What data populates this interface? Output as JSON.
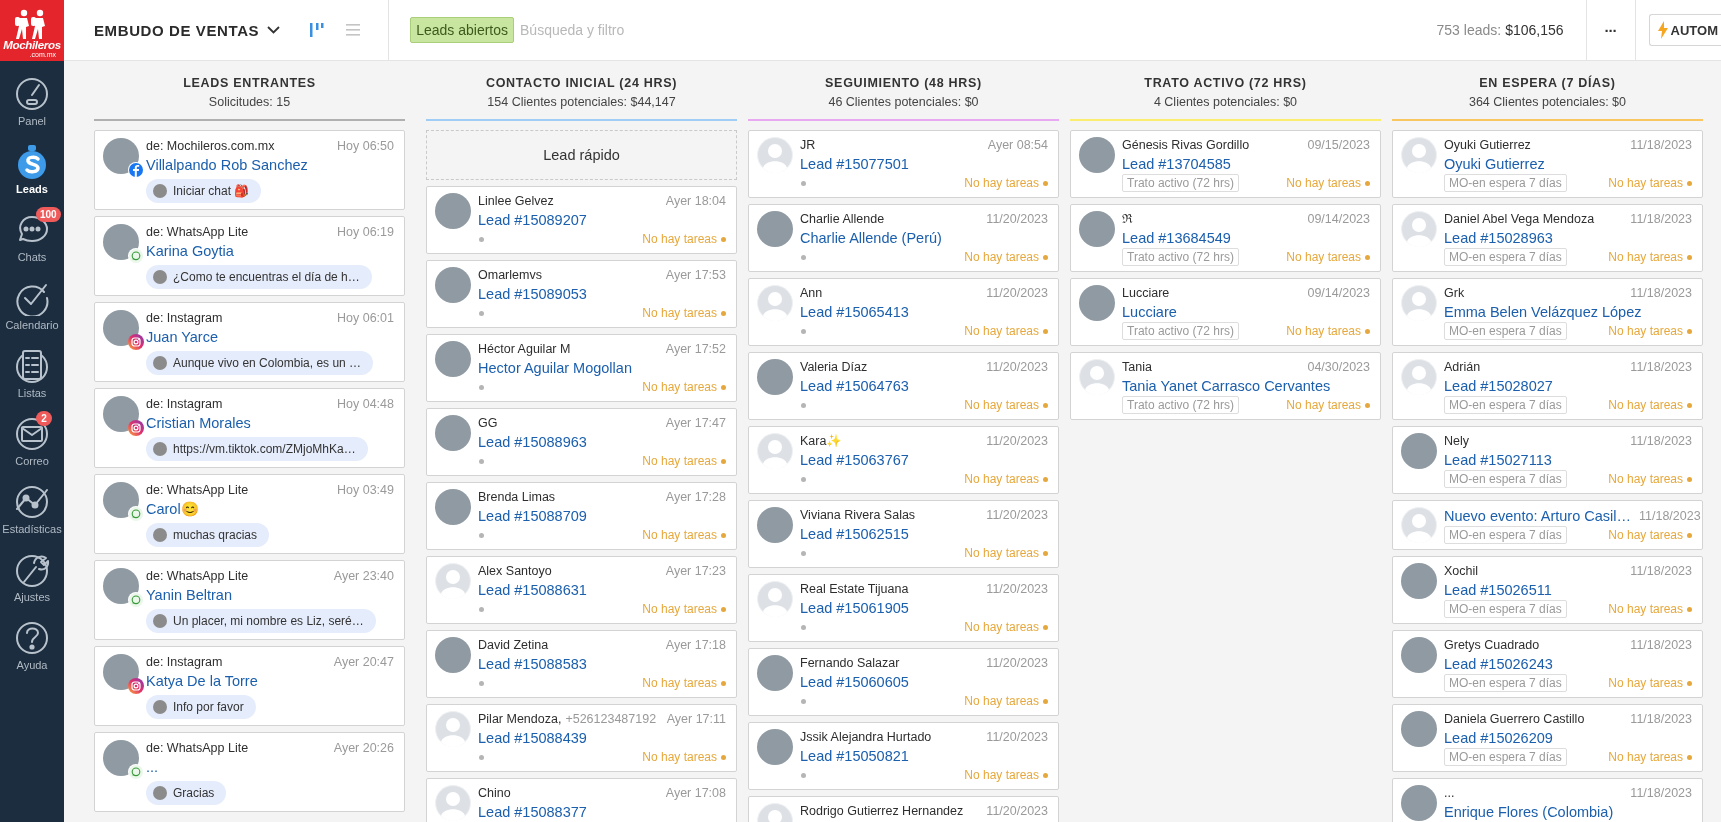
{
  "sidebar": {
    "logo": {
      "name": "Mochileros",
      "domain": ".com.mx"
    },
    "items": [
      {
        "label": "Panel",
        "kind": "gauge",
        "selected": false
      },
      {
        "label": "Leads",
        "kind": "leads",
        "selected": true
      },
      {
        "label": "Chats",
        "kind": "chats",
        "selected": false,
        "badge": "100"
      },
      {
        "label": "Calendario",
        "kind": "calendar",
        "selected": false
      },
      {
        "label": "Listas",
        "kind": "lists",
        "selected": false
      },
      {
        "label": "Correo",
        "kind": "mail",
        "selected": false,
        "badge": "2"
      },
      {
        "label": "Estadísticas",
        "kind": "stats",
        "selected": false
      },
      {
        "label": "Ajustes",
        "kind": "settings",
        "selected": false
      },
      {
        "label": "Ayuda",
        "kind": "help",
        "selected": false
      }
    ]
  },
  "top_bar": {
    "pipeline_title": "EMBUDO DE VENTAS",
    "views": [
      {
        "kind": "kanban",
        "selected": true
      },
      {
        "kind": "list",
        "selected": false
      }
    ],
    "search": {
      "filter_tag": "Leads abiertos",
      "placeholder": "Búsqueda y filtro"
    },
    "summary": {
      "count": "753 leads:",
      "total": "$106,156"
    },
    "more_button": "···",
    "automate_button": "AUTOM"
  },
  "columns": [
    {
      "title": "LEADS ENTRANTES",
      "subtitle": "Solicitudes: 15",
      "color": "#b0b0b0",
      "cards": [
        {
          "kind": "incoming",
          "avatar": {
            "kind": "photo"
          },
          "channel": {
            "kind": "facebook"
          },
          "source": "de: Mochileros.com.mx",
          "time": "Hoy 06:50",
          "name": "Villalpando Rob Sanchez",
          "message": "Iniciar chat 🎒"
        },
        {
          "kind": "incoming",
          "avatar": {
            "kind": "photo"
          },
          "channel": {
            "kind": "whatsapp"
          },
          "source": "de: WhatsApp Lite",
          "time": "Hoy 06:19",
          "name": "Karina Goytia",
          "message": "¿Como te encuentras el día de h…"
        },
        {
          "kind": "incoming",
          "avatar": {
            "kind": "photo"
          },
          "channel": {
            "kind": "instagram"
          },
          "source": "de: Instagram",
          "time": "Hoy 06:01",
          "name": "Juan Yarce",
          "message": "Aunque vivo en Colombia, es un …"
        },
        {
          "kind": "incoming",
          "avatar": {
            "kind": "photo"
          },
          "channel": {
            "kind": "instagram"
          },
          "source": "de: Instagram",
          "time": "Hoy 04:48",
          "name": "Cristian Morales",
          "message": "https://vm.tiktok.com/ZMjoMhKa…"
        },
        {
          "kind": "incoming",
          "avatar": {
            "kind": "photo"
          },
          "channel": {
            "kind": "whatsapp"
          },
          "source": "de: WhatsApp Lite",
          "time": "Hoy 03:49",
          "name": "Carol😊",
          "message": "muchas qracias"
        },
        {
          "kind": "incoming",
          "avatar": {
            "kind": "photo"
          },
          "channel": {
            "kind": "whatsapp"
          },
          "source": "de: WhatsApp Lite",
          "time": "Ayer 23:40",
          "name": "Yanin Beltran",
          "message": "Un placer, mi nombre es Liz, seré…"
        },
        {
          "kind": "incoming",
          "avatar": {
            "kind": "photo"
          },
          "channel": {
            "kind": "instagram"
          },
          "source": "de: Instagram",
          "time": "Ayer 20:47",
          "name": "Katya De la Torre",
          "message": "Info por favor"
        },
        {
          "kind": "incoming",
          "avatar": {
            "kind": "photo"
          },
          "channel": {
            "kind": "whatsapp"
          },
          "source": "de: WhatsApp Lite",
          "time": "Ayer 20:26",
          "name": "...",
          "message": "Gracias"
        }
      ]
    },
    {
      "title": "CONTACTO INICIAL (24 HRS)",
      "subtitle": "154 Clientes potenciales: $44,147",
      "color": "#9fcdf5",
      "quick_add": "Lead rápido",
      "cards": [
        {
          "kind": "deal",
          "avatar": {
            "kind": "photo"
          },
          "contact": "Linlee Gelvez",
          "time": "Ayer 18:04",
          "title": "Lead #15089207",
          "tasks": "No hay tareas"
        },
        {
          "kind": "deal",
          "avatar": {
            "kind": "photo"
          },
          "contact": "Omarlemvs",
          "time": "Ayer 17:53",
          "title": "Lead #15089053",
          "tasks": "No hay tareas"
        },
        {
          "kind": "deal",
          "avatar": {
            "kind": "photo"
          },
          "contact": "Héctor Aguilar M",
          "time": "Ayer 17:52",
          "title": "Hector Aguilar Mogollan",
          "tasks": "No hay tareas"
        },
        {
          "kind": "deal",
          "avatar": {
            "kind": "photo"
          },
          "contact": "GG",
          "time": "Ayer 17:47",
          "title": "Lead #15088963",
          "tasks": "No hay tareas"
        },
        {
          "kind": "deal",
          "avatar": {
            "kind": "photo"
          },
          "contact": "Brenda Limas",
          "time": "Ayer 17:28",
          "title": "Lead #15088709",
          "tasks": "No hay tareas"
        },
        {
          "kind": "deal",
          "avatar": {
            "kind": "default"
          },
          "contact": "Alex Santoyo",
          "time": "Ayer 17:23",
          "title": "Lead #15088631",
          "tasks": "No hay tareas"
        },
        {
          "kind": "deal",
          "avatar": {
            "kind": "photo"
          },
          "contact": "David Zetina",
          "time": "Ayer 17:18",
          "title": "Lead #15088583",
          "tasks": "No hay tareas"
        },
        {
          "kind": "deal",
          "avatar": {
            "kind": "default"
          },
          "contact": "Pilar Mendoza,",
          "phone": "+526123487192",
          "time": "Ayer 17:11",
          "title": "Lead #15088439",
          "tasks": "No hay tareas"
        },
        {
          "kind": "deal",
          "avatar": {
            "kind": "default"
          },
          "contact": "Chino",
          "time": "Ayer 17:08",
          "title": "Lead #15088377"
        }
      ]
    },
    {
      "title": "SEGUIMIENTO (48 HRS)",
      "subtitle": "46 Clientes potenciales: $0",
      "color": "#e9a8f2",
      "cards": [
        {
          "kind": "deal",
          "avatar": {
            "kind": "default"
          },
          "contact": "JR",
          "time": "Ayer 08:54",
          "title": "Lead #15077501",
          "tasks": "No hay tareas"
        },
        {
          "kind": "deal",
          "avatar": {
            "kind": "photo"
          },
          "contact": "Charlie Allende",
          "time": "11/20/2023",
          "title": "Charlie Allende (Perú)",
          "tasks": "No hay tareas"
        },
        {
          "kind": "deal",
          "avatar": {
            "kind": "default"
          },
          "contact": "Ann",
          "time": "11/20/2023",
          "title": "Lead #15065413",
          "tasks": "No hay tareas"
        },
        {
          "kind": "deal",
          "avatar": {
            "kind": "photo"
          },
          "contact": "Valeria Díaz",
          "time": "11/20/2023",
          "title": "Lead #15064763",
          "tasks": "No hay tareas"
        },
        {
          "kind": "deal",
          "avatar": {
            "kind": "default"
          },
          "contact": "Kara✨",
          "time": "11/20/2023",
          "title": "Lead #15063767",
          "tasks": "No hay tareas"
        },
        {
          "kind": "deal",
          "avatar": {
            "kind": "photo"
          },
          "contact": "Viviana Rivera Salas",
          "time": "11/20/2023",
          "title": "Lead #15062515",
          "tasks": "No hay tareas"
        },
        {
          "kind": "deal",
          "avatar": {
            "kind": "default"
          },
          "contact": "Real Estate Tijuana",
          "time": "11/20/2023",
          "title": "Lead #15061905",
          "tasks": "No hay tareas"
        },
        {
          "kind": "deal",
          "avatar": {
            "kind": "photo"
          },
          "contact": "Fernando Salazar",
          "time": "11/20/2023",
          "title": "Lead #15060605",
          "tasks": "No hay tareas"
        },
        {
          "kind": "deal",
          "avatar": {
            "kind": "photo"
          },
          "contact": "Jssik Alejandra Hurtado",
          "time": "11/20/2023",
          "title": "Lead #15050821",
          "tasks": "No hay tareas"
        },
        {
          "kind": "deal",
          "avatar": {
            "kind": "default"
          },
          "contact": "Rodrigo Gutierrez Hernandez",
          "time": "11/20/2023"
        }
      ]
    },
    {
      "title": "TRATO ACTIVO (72 HRS)",
      "subtitle": "4 Clientes potenciales: $0",
      "color": "#fbee6e",
      "cards": [
        {
          "kind": "deal",
          "avatar": {
            "kind": "photo"
          },
          "contact": "Génesis Rivas Gordillo",
          "time": "09/15/2023",
          "title": "Lead #13704585",
          "tag": "Trato activo (72 hrs)",
          "tasks": "No hay tareas"
        },
        {
          "kind": "deal",
          "avatar": {
            "kind": "photo"
          },
          "contact": "ℜ",
          "time": "09/14/2023",
          "title": "Lead #13684549",
          "tag": "Trato activo (72 hrs)",
          "tasks": "No hay tareas"
        },
        {
          "kind": "deal",
          "avatar": {
            "kind": "photo"
          },
          "contact": "Lucciare",
          "time": "09/14/2023",
          "title": "Lucciare",
          "tag": "Trato activo (72 hrs)",
          "tasks": "No hay tareas"
        },
        {
          "kind": "deal",
          "avatar": {
            "kind": "default"
          },
          "contact": "Tania",
          "time": "04/30/2023",
          "title": "Tania Yanet Carrasco Cervantes",
          "tag": "Trato activo (72 hrs)",
          "tasks": "No hay tareas"
        }
      ]
    },
    {
      "title": "EN ESPERA (7 DÍAS)",
      "subtitle": "364 Clientes potenciales: $0",
      "color": "#f9c660",
      "cards": [
        {
          "kind": "deal",
          "avatar": {
            "kind": "default"
          },
          "contact": "Oyuki Gutierrez",
          "time": "11/18/2023",
          "title": "Oyuki Gutierrez",
          "tag": "MO-en espera 7 días",
          "tasks": "No hay tareas"
        },
        {
          "kind": "deal",
          "avatar": {
            "kind": "default"
          },
          "contact": "Daniel Abel Vega Mendoza",
          "time": "11/18/2023",
          "title": "Lead #15028963",
          "tag": "MO-en espera 7 días",
          "tasks": "No hay tareas"
        },
        {
          "kind": "deal",
          "avatar": {
            "kind": "default"
          },
          "contact": "Grk",
          "time": "11/18/2023",
          "title": "Emma Belen Velázquez López",
          "tag": "MO-en espera 7 días",
          "tasks": "No hay tareas"
        },
        {
          "kind": "deal",
          "avatar": {
            "kind": "default"
          },
          "contact": "Adrián",
          "time": "11/18/2023",
          "title": "Lead #15028027",
          "tag": "MO-en espera 7 días",
          "tasks": "No hay tareas"
        },
        {
          "kind": "deal",
          "avatar": {
            "kind": "photo"
          },
          "contact": "Nely",
          "time": "11/18/2023",
          "title": "Lead #15027113",
          "tag": "MO-en espera 7 días",
          "tasks": "No hay tareas"
        },
        {
          "kind": "deal",
          "avatar": {
            "kind": "default"
          },
          "time": "11/18/2023",
          "title": "Nuevo evento: Arturo Casil…",
          "tag": "MO-en espera 7 días",
          "tasks": "No hay tareas"
        },
        {
          "kind": "deal",
          "avatar": {
            "kind": "photo"
          },
          "contact": "Xochil",
          "time": "11/18/2023",
          "title": "Lead #15026511",
          "tag": "MO-en espera 7 días",
          "tasks": "No hay tareas"
        },
        {
          "kind": "deal",
          "avatar": {
            "kind": "photo"
          },
          "contact": "Gretys Cuadrado",
          "time": "11/18/2023",
          "title": "Lead #15026243",
          "tag": "MO-en espera 7 días",
          "tasks": "No hay tareas"
        },
        {
          "kind": "deal",
          "avatar": {
            "kind": "photo"
          },
          "contact": "Daniela Guerrero Castillo",
          "time": "11/18/2023",
          "title": "Lead #15026209",
          "tag": "MO-en espera 7 días",
          "tasks": "No hay tareas"
        },
        {
          "kind": "deal",
          "avatar": {
            "kind": "photo"
          },
          "contact": "...",
          "time": "11/18/2023",
          "title": "Enrique Flores (Colombia)"
        }
      ]
    }
  ]
}
